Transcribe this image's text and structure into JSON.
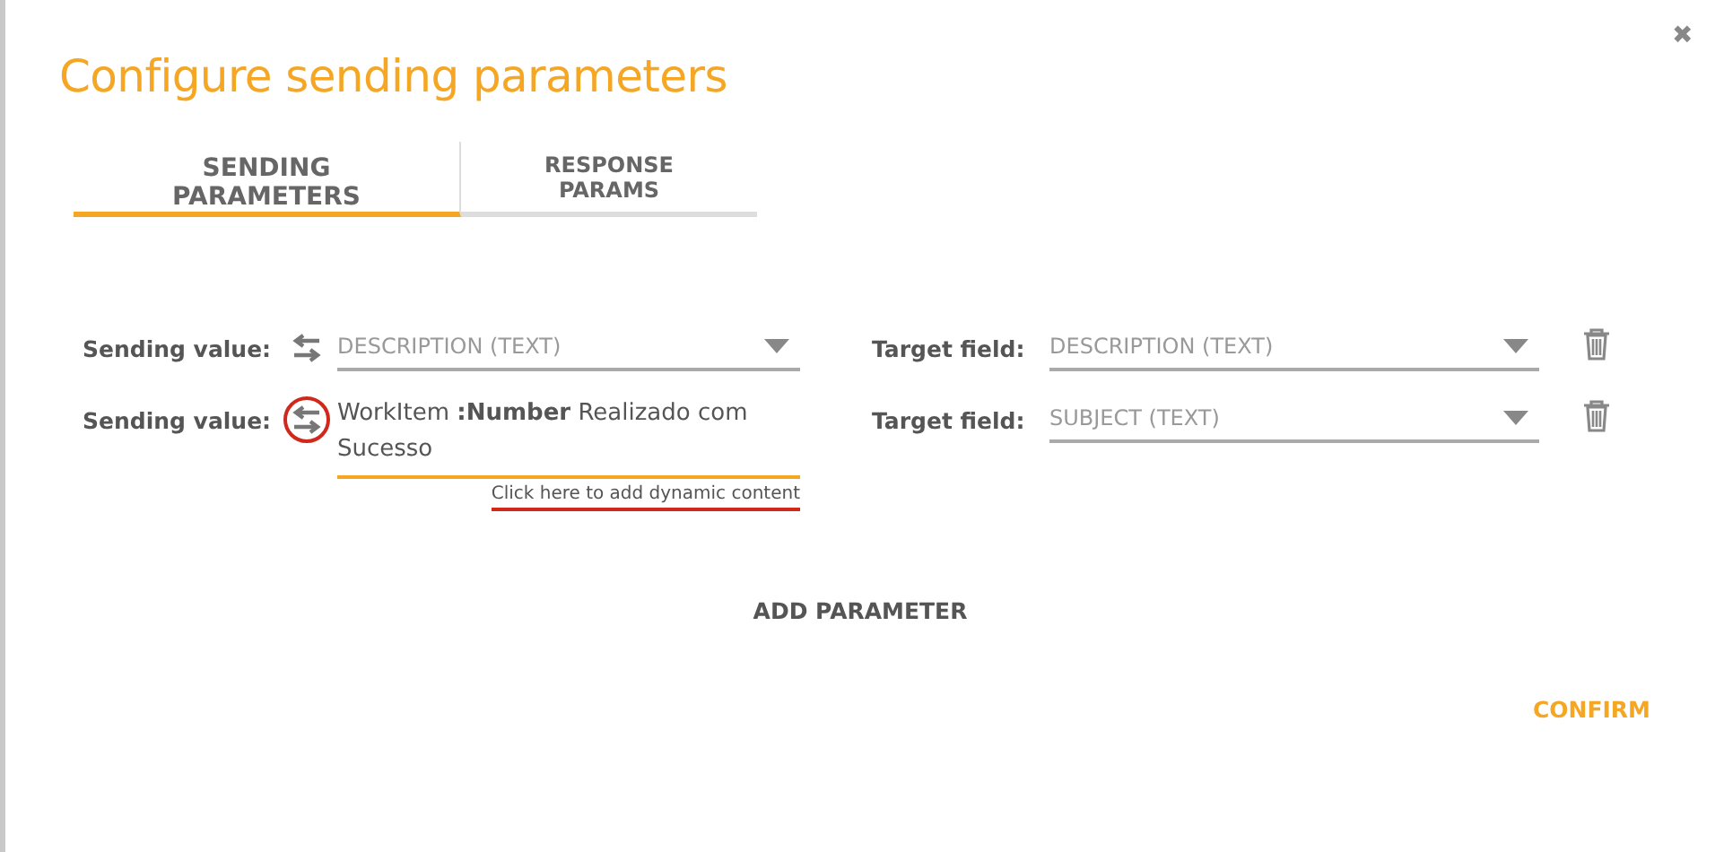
{
  "dialog": {
    "title": "Configure sending parameters",
    "close": "✖"
  },
  "tabs": [
    {
      "label": "SENDING PARAMETERS",
      "selected": true
    },
    {
      "label": "RESPONSE PARAMS",
      "selected": false
    }
  ],
  "parameters": [
    {
      "sending_label": "Sending value:",
      "highlighted": false,
      "kind": "select",
      "value": "DESCRIPTION (TEXT)",
      "target_label": "Target field:",
      "target": "DESCRIPTION (TEXT)"
    },
    {
      "sending_label": "Sending value:",
      "highlighted": true,
      "kind": "text",
      "value": "WorkItem **:Number** Realizado com Sucesso",
      "link": "Click here to add dynamic content",
      "target_label": "Target field:",
      "target": "SUBJECT (TEXT)"
    }
  ],
  "add_button": "ADD PARAMETER",
  "confirm_button": "CONFIRM"
}
